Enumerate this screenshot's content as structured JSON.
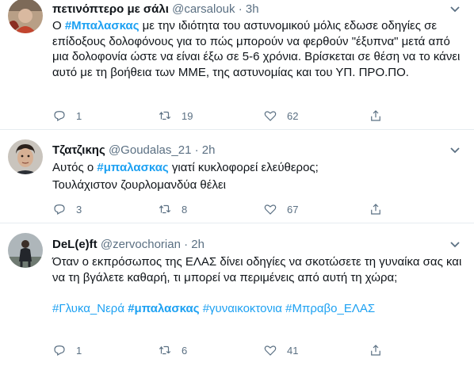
{
  "tweets": [
    {
      "name": "πετινόπτερο με σάλι",
      "handle": "@carsalouk",
      "sep": "·",
      "time": "3h",
      "body_pre": "Ο ",
      "hashtag": "#Μπαλασκας",
      "body_post": " με την ιδιότητα του αστυνομικού μόλις εδωσε οδηγίες σε επίδοξους δολοφόνους για το πώς μπορούν να φερθούν \"έξυπνα\" μετά από μια δολοφονία ώστε να είναι έξω σε 5-6 χρόνια. Βρίσκεται σε θέση να το κάνει αυτό με τη βοήθεια των ΜΜΕ, της αστυνομίας και του ΥΠ. ΠΡΟ.ΠΟ.",
      "replies": "1",
      "retweets": "19",
      "likes": "62"
    },
    {
      "name": "Τζατζικης",
      "handle": "@Goudalas_21",
      "sep": "·",
      "time": "2h",
      "line1_pre": "Αυτός ο ",
      "hashtag": "#μπαλασκας",
      "line1_post": " γιατί κυκλοφορεί ελεύθερος;",
      "line2": "Τουλάχιστον ζουρλομανδύα θέλει",
      "replies": "3",
      "retweets": "8",
      "likes": "67"
    },
    {
      "name": "DeL(e)ft",
      "handle": "@zervochorian",
      "sep": "·",
      "time": "2h",
      "body": "Όταν ο εκπρόσωπος της ΕΛΑΣ δίνει οδηγίες να σκοτώσετε τη γυναίκα σας και να τη βγάλετε καθαρή, τι μπορεί να περιμένεις από αυτή τη χώρα;",
      "tag1": "#Γλυκα_Νερά",
      "tag2": "#μπαλασκας",
      "tag3": "#γυναικοκτονια",
      "tag4": "#Μπραβο_ΕΛΑΣ",
      "replies": "1",
      "retweets": "6",
      "likes": "41"
    }
  ],
  "icons": {
    "reply": "reply-icon",
    "retweet": "retweet-icon",
    "like": "heart-icon",
    "share": "share-icon",
    "more": "chevron-down-icon"
  },
  "colors": {
    "accent": "#1da1f2",
    "secondary": "#5b7083",
    "divider": "#e6ecf0"
  }
}
